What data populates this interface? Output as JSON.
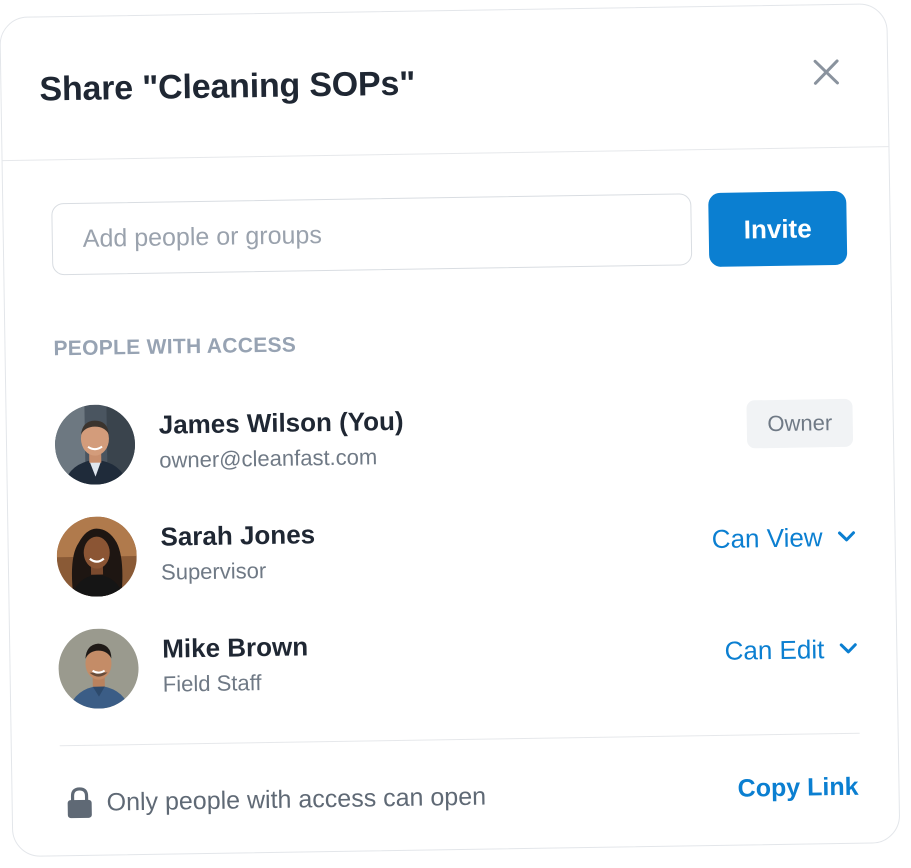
{
  "dialog": {
    "title": "Share \"Cleaning SOPs\""
  },
  "invite": {
    "placeholder": "Add people or groups",
    "value": "",
    "button_label": "Invite"
  },
  "access": {
    "section_label": "PEOPLE WITH ACCESS",
    "people": [
      {
        "name": "James Wilson (You)",
        "subtitle": "owner@cleanfast.com",
        "role": "Owner",
        "role_type": "badge",
        "avatar": "photo-man-suit"
      },
      {
        "name": "Sarah Jones",
        "subtitle": "Supervisor",
        "role": "Can View",
        "role_type": "dropdown",
        "avatar": "photo-woman"
      },
      {
        "name": "Mike Brown",
        "subtitle": "Field Staff",
        "role": "Can Edit",
        "role_type": "dropdown",
        "avatar": "photo-man-denim"
      }
    ]
  },
  "footer": {
    "access_text": "Only people with access can open",
    "copy_link_label": "Copy Link",
    "icon": "lock-icon"
  },
  "colors": {
    "accent": "#0b7fd1",
    "title": "#1f2733",
    "muted": "#6f7985",
    "section_label": "#97a3b3",
    "badge_bg": "#f1f3f5"
  }
}
